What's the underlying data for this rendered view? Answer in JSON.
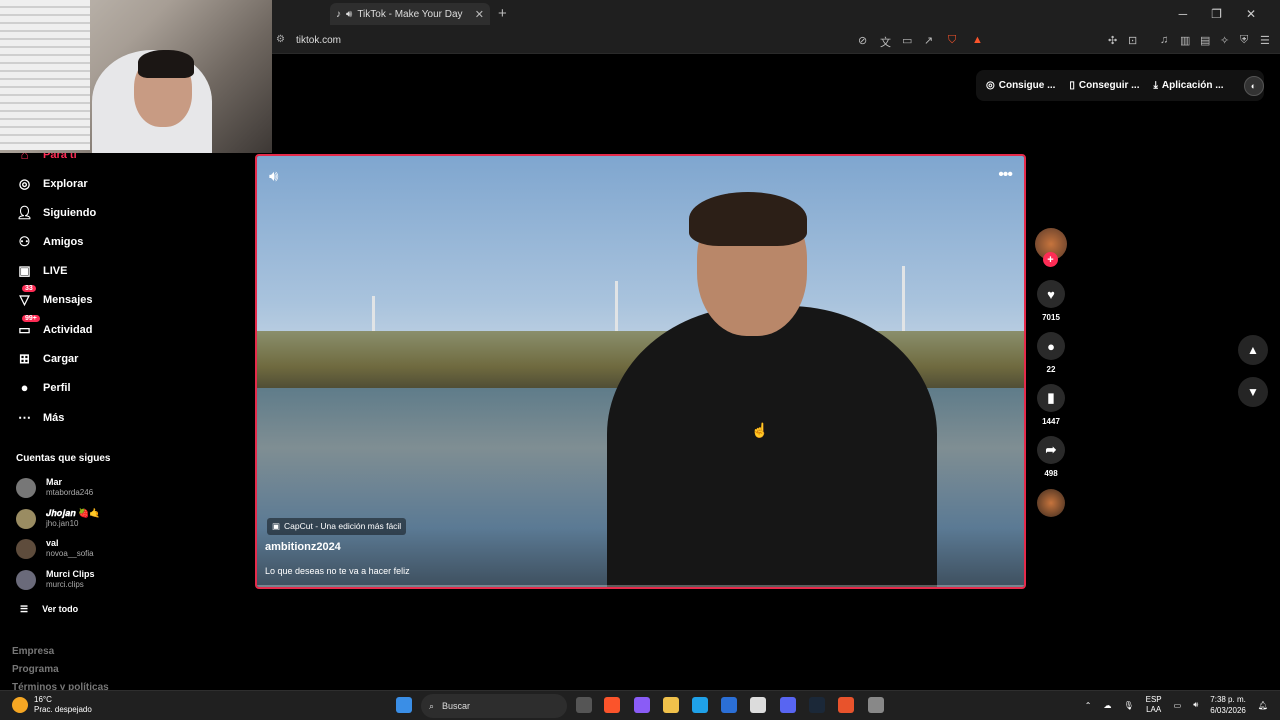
{
  "browser": {
    "tab_title": "TikTok - Make Your Day",
    "new_tab": "+",
    "tab_close": "✕",
    "url": "tiktok.com",
    "window_controls": [
      "─",
      "❐",
      "✕"
    ]
  },
  "header": {
    "coins": "Consigue ...",
    "get_app": "Conseguir ...",
    "app": "Aplicación ..."
  },
  "sidebar": {
    "items": [
      {
        "label": "Para ti",
        "icon": "home-icon"
      },
      {
        "label": "Explorar",
        "icon": "compass-icon"
      },
      {
        "label": "Siguiendo",
        "icon": "user-follow-icon"
      },
      {
        "label": "Amigos",
        "icon": "friends-icon"
      },
      {
        "label": "LIVE",
        "icon": "tv-icon"
      },
      {
        "label": "Mensajes",
        "icon": "message-icon",
        "badge": "33"
      },
      {
        "label": "Actividad",
        "icon": "inbox-icon",
        "badge": "99+"
      },
      {
        "label": "Cargar",
        "icon": "plus-square-icon"
      },
      {
        "label": "Perfil",
        "icon": "profile-icon"
      },
      {
        "label": "Más",
        "icon": "more-icon"
      }
    ],
    "following_title": "Cuentas que sigues",
    "accounts": [
      {
        "name": "Mar",
        "handle": "mtaborda246"
      },
      {
        "name": "𝑱𝒉𝒐𝒋𝒂𝒏 🍓🤙",
        "handle": "jho.jan10"
      },
      {
        "name": "val",
        "handle": "novoa__sofia"
      },
      {
        "name": "Murci Clips",
        "handle": "murci.clips"
      }
    ],
    "see_all": "Ver todo",
    "footer": [
      "Empresa",
      "Programa",
      "Términos y políticas"
    ]
  },
  "video": {
    "capcut_label": "CapCut - Una edición más fácil",
    "author": "ambitionz2024",
    "caption": "Lo que deseas no te va a hacer feliz",
    "likes": "7015",
    "comments": "22",
    "saves": "1447",
    "shares": "498"
  },
  "taskbar": {
    "temperature": "16°C",
    "weather": "Prac. despejado",
    "search_placeholder": "Buscar",
    "lang": "ESP",
    "lang2": "LAA",
    "time": "7:38 p. m.",
    "date": "6/03/2026"
  },
  "colors": {
    "accent": "#fe2c55",
    "video_border": "#e52b4b",
    "background": "#000000"
  }
}
